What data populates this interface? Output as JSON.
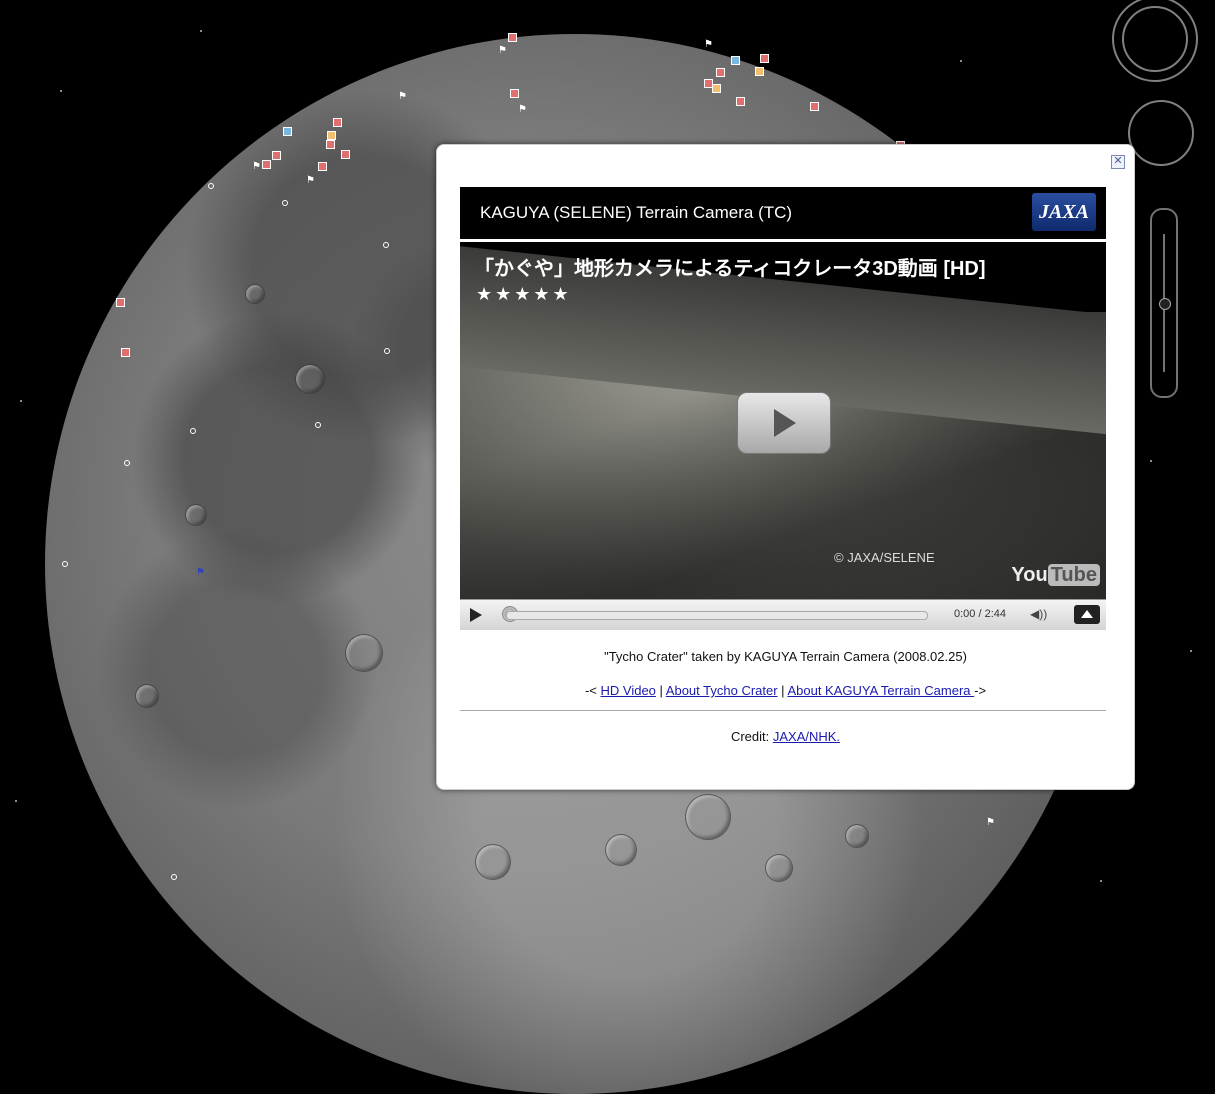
{
  "balloon": {
    "close_glyph": "✕",
    "header_title": "KAGUYA (SELENE) Terrain Camera (TC)",
    "logo_text": "JAXA",
    "video": {
      "title": "「かぐや」地形カメラによるティコクレータ3D動画 [HD]",
      "stars": "★★★★★",
      "watermark": "© JAXA/SELENE",
      "youtube_you": "You",
      "youtube_tube": "Tube",
      "time": "0:00 / 2:44",
      "volume_glyph": "◀))"
    },
    "caption": "\"Tycho Crater\" taken by KAGUYA Terrain Camera (2008.02.25)",
    "links_prefix": "-< ",
    "links": [
      "HD Video",
      "About Tycho Crater",
      "About KAGUYA Terrain Camera "
    ],
    "links_sep": " | ",
    "links_suffix": "->",
    "credit_label": "Credit: ",
    "credit_link": "JAXA/NHK."
  }
}
